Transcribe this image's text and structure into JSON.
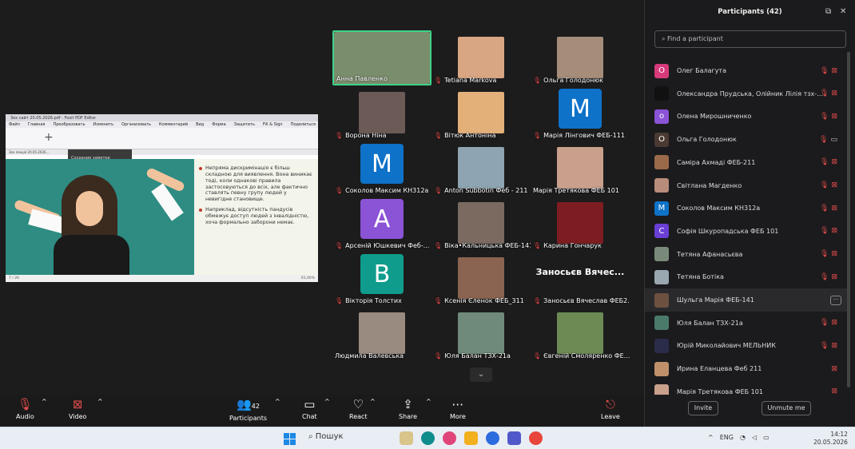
{
  "shared_screen": {
    "window_title": "3ex сайт 20.05.2026.pdf - Foxit PDF Editor",
    "menu": [
      "Файл",
      "Главная",
      "Преобразовать",
      "Изменить",
      "Организовать",
      "Комментарий",
      "Вид",
      "Форма",
      "Защитить",
      "Fill & Sign",
      "Поделиться",
      "Специальные"
    ],
    "doc_tab": "3ex лекція 20.05.2026...",
    "tooltip": "Создание заметки",
    "bullets": [
      "Непряма дискримінація є більш складною для виявлення. Вона виникає тоді, коли однакові правила застосовуються до всіх, але фактично ставлять певну групу людей у невигідне становище.",
      "Наприклад, відсутність пандусів обмежує доступ людей з інвалідністю, хоча формально заборони немає."
    ],
    "page_indicator": "7 / 26",
    "zoom": "61,00%"
  },
  "tiles": [
    {
      "name": "Анна Павленко",
      "muted": false,
      "active": true,
      "color": "#7a8d6c"
    },
    {
      "name": "Tetiana Markova",
      "muted": true,
      "color": "#d9a684"
    },
    {
      "name": "Ольга Голодонюк",
      "muted": true,
      "color": "#a58d7a"
    },
    {
      "name": "Ворона Ніна",
      "muted": true,
      "color": "#6b5a56"
    },
    {
      "name": "Вітюк Антоніна",
      "muted": true,
      "color": "#e4b07a"
    },
    {
      "name": "Марія Лінгович ФЕБ-111",
      "muted": true,
      "initial": "M",
      "color": "#0e72c8"
    },
    {
      "name": "Соколов Максим КН312а",
      "muted": true,
      "initial": "M",
      "color": "#0e72c8"
    },
    {
      "name": "Anton Subbotin Феб - 211",
      "muted": true,
      "color": "#8ea4b2"
    },
    {
      "name": "Марія Третякова ФЕБ 101",
      "muted": false,
      "color": "#c9a08c"
    },
    {
      "name": "Арсеній Юшкевич Феб-...",
      "muted": true,
      "initial": "A",
      "color": "#8b53d6"
    },
    {
      "name": "Віка•Кальницька ФЕБ-141",
      "muted": true,
      "color": "#7a6a60"
    },
    {
      "name": "Карина Гончарук",
      "muted": true,
      "color": "#7d1d22"
    },
    {
      "name": "Вікторія Толстих",
      "muted": true,
      "initial": "B",
      "color": "#0f9c8c"
    },
    {
      "name": "Ксенія Єленок ФЕБ_311",
      "muted": true,
      "color": "#8a6450"
    },
    {
      "name": "Заносьєв Вячеслав ФЕБ2...",
      "muted": true,
      "bigname": "Заносьєв Вячес...",
      "color": "#1c1c1c"
    },
    {
      "name": "Людмила Валевська",
      "muted": false,
      "color": "#9a8b80"
    },
    {
      "name": "Юля Балан ТЗХ-21а",
      "muted": true,
      "color": "#6f8a7a"
    },
    {
      "name": "Євгеній Смоляренко ФЕ...",
      "muted": true,
      "color": "#6d8a55"
    }
  ],
  "controls": {
    "audio": "Audio",
    "video": "Video",
    "participants": "Participants",
    "participants_count": "42",
    "chat": "Chat",
    "react": "React",
    "share": "Share",
    "more": "More",
    "leave": "Leave"
  },
  "panel": {
    "title": "Participants (42)",
    "search_placeholder": "Find a participant",
    "participants": [
      {
        "name": "Олег Балагута",
        "initial": "O",
        "color": "#d63a7a"
      },
      {
        "name": "Олександра Прудська, Олійник Лілія тзх-1...",
        "initial": "",
        "color": "#111"
      },
      {
        "name": "Олена Мирошниченко",
        "initial": "o",
        "color": "#8b53d6"
      },
      {
        "name": "Ольга Голодонюк",
        "initial": "O",
        "color": "#4a3a33",
        "video_on": true
      },
      {
        "name": "Саміра Ахмаді ФЕБ-211",
        "initial": "",
        "color": "#9b6a4a"
      },
      {
        "name": "Світлана Магденко",
        "initial": "",
        "color": "#b88c7a"
      },
      {
        "name": "Соколов Максим КН312а",
        "initial": "M",
        "color": "#0e72c8"
      },
      {
        "name": "Софія Шкуропадська ФЕБ 101",
        "initial": "C",
        "color": "#6a3fd6"
      },
      {
        "name": "Тетяна Афанасьєва",
        "initial": "",
        "color": "#7a8a7a"
      },
      {
        "name": "Тетяна Ботіка",
        "initial": "",
        "color": "#9aa6b0"
      },
      {
        "name": "Шульга Марія ФЕБ-141",
        "initial": "",
        "color": "#6d5040",
        "hover": true
      },
      {
        "name": "Юля Балан ТЗХ-21а",
        "initial": "",
        "color": "#4a7a6a"
      },
      {
        "name": "Юрій Миколайович МЕЛЬНИК",
        "initial": "",
        "color": "#2b2b4a"
      },
      {
        "name": "Ирина Еланцева Феб 211",
        "initial": "",
        "color": "#c0906a",
        "video_only": true
      },
      {
        "name": "Марія Третякова ФЕБ 101",
        "initial": "",
        "color": "#c9a08c",
        "video_only": true
      }
    ],
    "invite": "Invite",
    "unmute": "Unmute me"
  },
  "taskbar": {
    "search": "Пошук",
    "lang": "ENG",
    "time": "14:12",
    "date": "20.05.2026"
  }
}
